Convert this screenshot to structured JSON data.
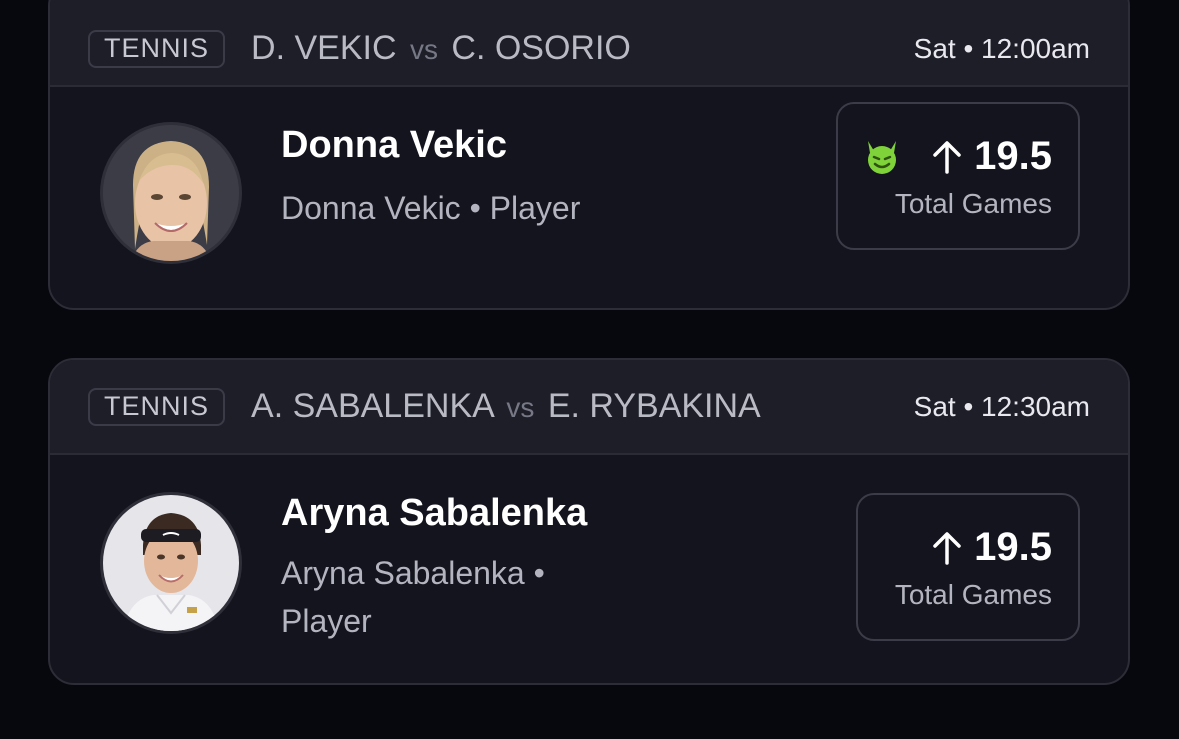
{
  "cards": [
    {
      "sport": "TENNIS",
      "team_a": "D. VEKIC",
      "vs": "vs",
      "team_b": "C. OSORIO",
      "time": "Sat • 12:00am",
      "player_name": "Donna Vekic",
      "player_sub": "Donna Vekic • Player",
      "prop_value": "19.5",
      "prop_stat": "Total Games",
      "direction": "up",
      "icons": [
        "demon-icon",
        "arrow-up-icon"
      ],
      "accent": "#7fd23a"
    },
    {
      "sport": "TENNIS",
      "team_a": "A. SABALENKA",
      "vs": "vs",
      "team_b": "E. RYBAKINA",
      "time": "Sat • 12:30am",
      "player_name": "Aryna Sabalenka",
      "player_sub": "Aryna Sabalenka • Player",
      "prop_value": "19.5",
      "prop_stat": "Total Games",
      "direction": "up",
      "icons": [
        "arrow-up-icon"
      ]
    }
  ],
  "colors": {
    "background": "#07080e",
    "card": "#13141d",
    "header": "#1d1e28",
    "demon_green": "#7fd23a"
  }
}
